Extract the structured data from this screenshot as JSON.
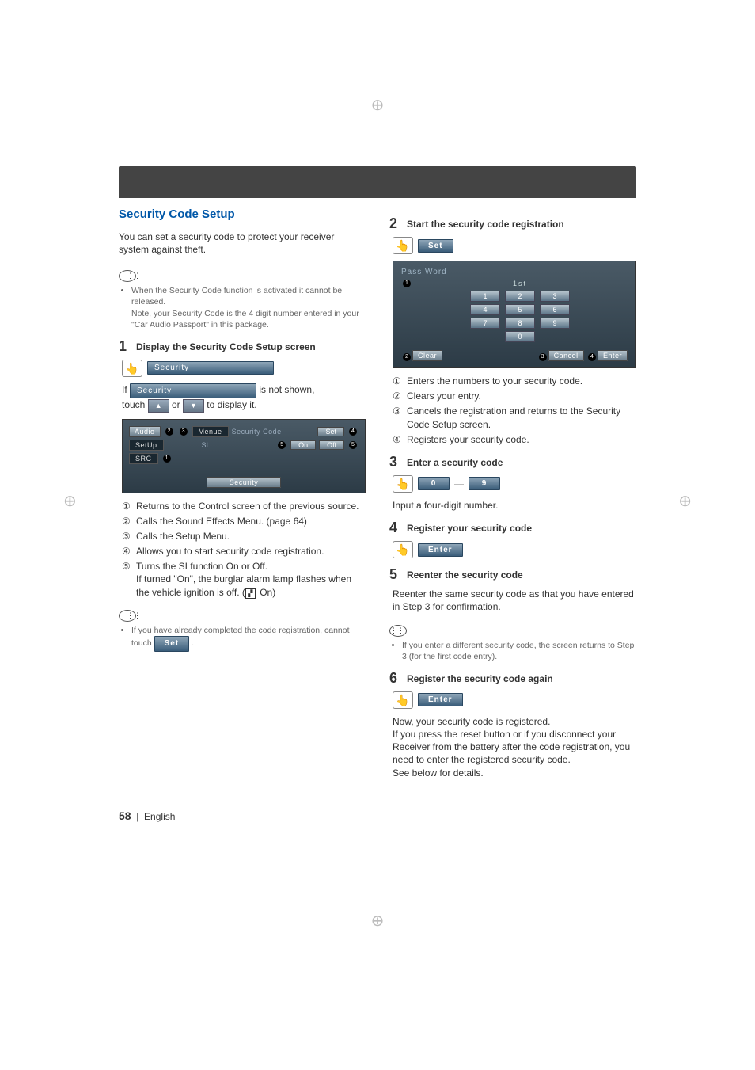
{
  "header": {
    "title": ""
  },
  "left": {
    "heading": "Security Code Setup",
    "intro": "You can set a security code to protect your receiver system against theft.",
    "note1a": "When the Security Code function is activated it cannot be released.",
    "note1b": "Note, your Security Code is the 4 digit number entered in your \"Car Audio Passport\" in this package.",
    "step1title": "Display the Security Code Setup screen",
    "btn_security": "Security",
    "if_text_a": "If",
    "btn_security_long": "Security",
    "if_text_b": "is not shown,",
    "touch_text_a": "touch",
    "btn_up": "▲",
    "or_text": "or",
    "btn_down": "▼",
    "touch_text_b": "to display it.",
    "screen1": {
      "audio": "Audio",
      "setup": "SetUp",
      "src": "SRC",
      "menue": "Menue",
      "sc_label": "Security Code",
      "set": "Set",
      "si": "SI",
      "on": "On",
      "off": "Off",
      "footer": "Security"
    },
    "markers": {
      "m1": "1",
      "m2": "2",
      "m3": "3",
      "m4": "4",
      "m5": "5"
    },
    "list1": {
      "i1": "Returns to the Control screen of the previous source.",
      "i2": "Calls the Sound Effects Menu. (page 64)",
      "i3": "Calls the Setup Menu.",
      "i4": "Allows you to start security code registration.",
      "i5a": "Turns the SI function On or Off.",
      "i5b": "If turned  \"On\", the burglar alarm lamp flashes when the vehicle ignition is off. (",
      "i5c": " On)"
    },
    "note2a": "If you have already completed the code registration, cannot touch ",
    "note2_btn": "Set",
    "note2b": "."
  },
  "right": {
    "step2title": "Start the security code registration",
    "btn_set": "Set",
    "keypad": {
      "title": "Pass Word",
      "sub": "1st",
      "k1": "1",
      "k2": "2",
      "k3": "3",
      "k4": "4",
      "k5": "5",
      "k6": "6",
      "k7": "7",
      "k8": "8",
      "k9": "9",
      "k0": "0",
      "clear": "Clear",
      "cancel": "Cancel",
      "enter": "Enter"
    },
    "list2": {
      "i1": "Enters the numbers to your security code.",
      "i2": "Clears your entry.",
      "i3": "Cancels the registration and returns to the Security Code Setup screen.",
      "i4": "Registers your security code."
    },
    "step3title": "Enter a security code",
    "btn_0": "0",
    "dash": "—",
    "btn_9": "9",
    "step3body": "Input a four-digit number.",
    "step4title": "Register your security code",
    "btn_enter4": "Enter",
    "step5title": "Reenter the security code",
    "step5body": "Reenter the same security code as that you have entered in Step 3 for confirmation.",
    "note3": "If you enter a different security code, the screen returns to Step 3 (for the first code entry).",
    "step6title": "Register the security code again",
    "btn_enter6": "Enter",
    "step6body": "Now, your security code is registered.\nIf you press the reset button or if you disconnect your Receiver from the battery after the code registration, you need to enter the registered security code.\nSee below for details."
  },
  "footer": {
    "page": "58",
    "sep": "|",
    "lang": "English"
  }
}
